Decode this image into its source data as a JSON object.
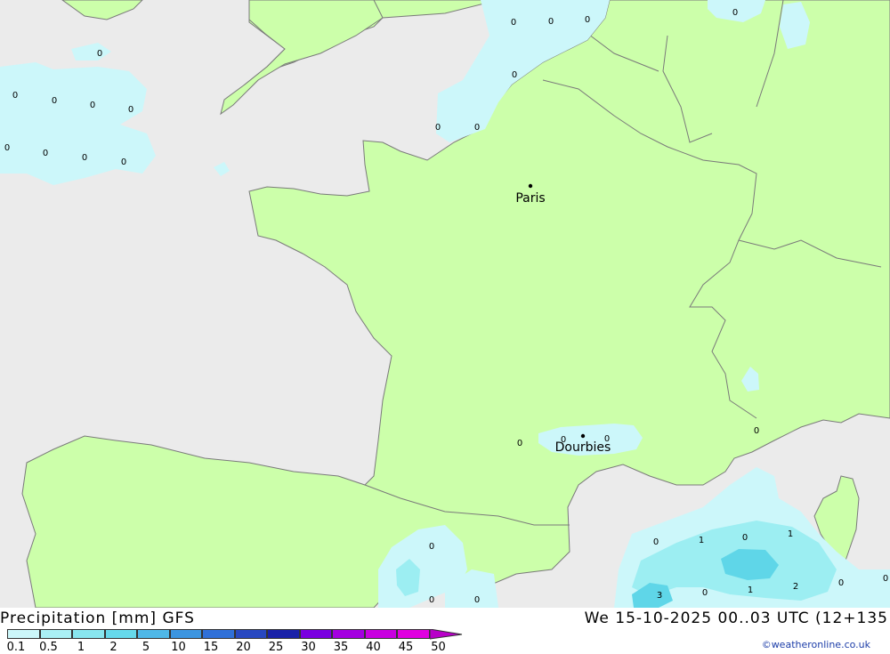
{
  "header": {
    "title": "Precipitation [mm] GFS",
    "datetime": "We 15-10-2025 00..03 UTC (12+135"
  },
  "credit": "©weatheronline.co.uk",
  "colors": {
    "sea": "#ebebeb",
    "land": "#ccffaa",
    "border": "#7a7a7a",
    "precip_light": "#ccf7fa",
    "precip_mid": "#9ceef2",
    "precip_heavy": "#5fd6e8"
  },
  "cities": [
    {
      "name": "Paris"
    },
    {
      "name": "Dourbies"
    }
  ],
  "precip_values": [
    "0",
    "0",
    "0",
    "0",
    "0",
    "0",
    "0",
    "0",
    "0",
    "0",
    "0",
    "0",
    "0",
    "0",
    "0",
    "0",
    "0",
    "0",
    "0",
    "0",
    "0",
    "0",
    "0",
    "0",
    "1",
    "0",
    "1",
    "3",
    "0",
    "1",
    "2",
    "0",
    "0"
  ],
  "legend": {
    "ticks": [
      "0.1",
      "0.5",
      "1",
      "2",
      "5",
      "10",
      "15",
      "20",
      "25",
      "30",
      "35",
      "40",
      "45",
      "50"
    ],
    "colors": [
      "#ccf7fa",
      "#aaf0f5",
      "#88e6ef",
      "#66d9eb",
      "#4fb8e8",
      "#3c95e0",
      "#3070d8",
      "#2848c0",
      "#1a22a8",
      "#7a00e0",
      "#a400e0",
      "#c800e0",
      "#e000e0",
      "#b800c8"
    ]
  }
}
